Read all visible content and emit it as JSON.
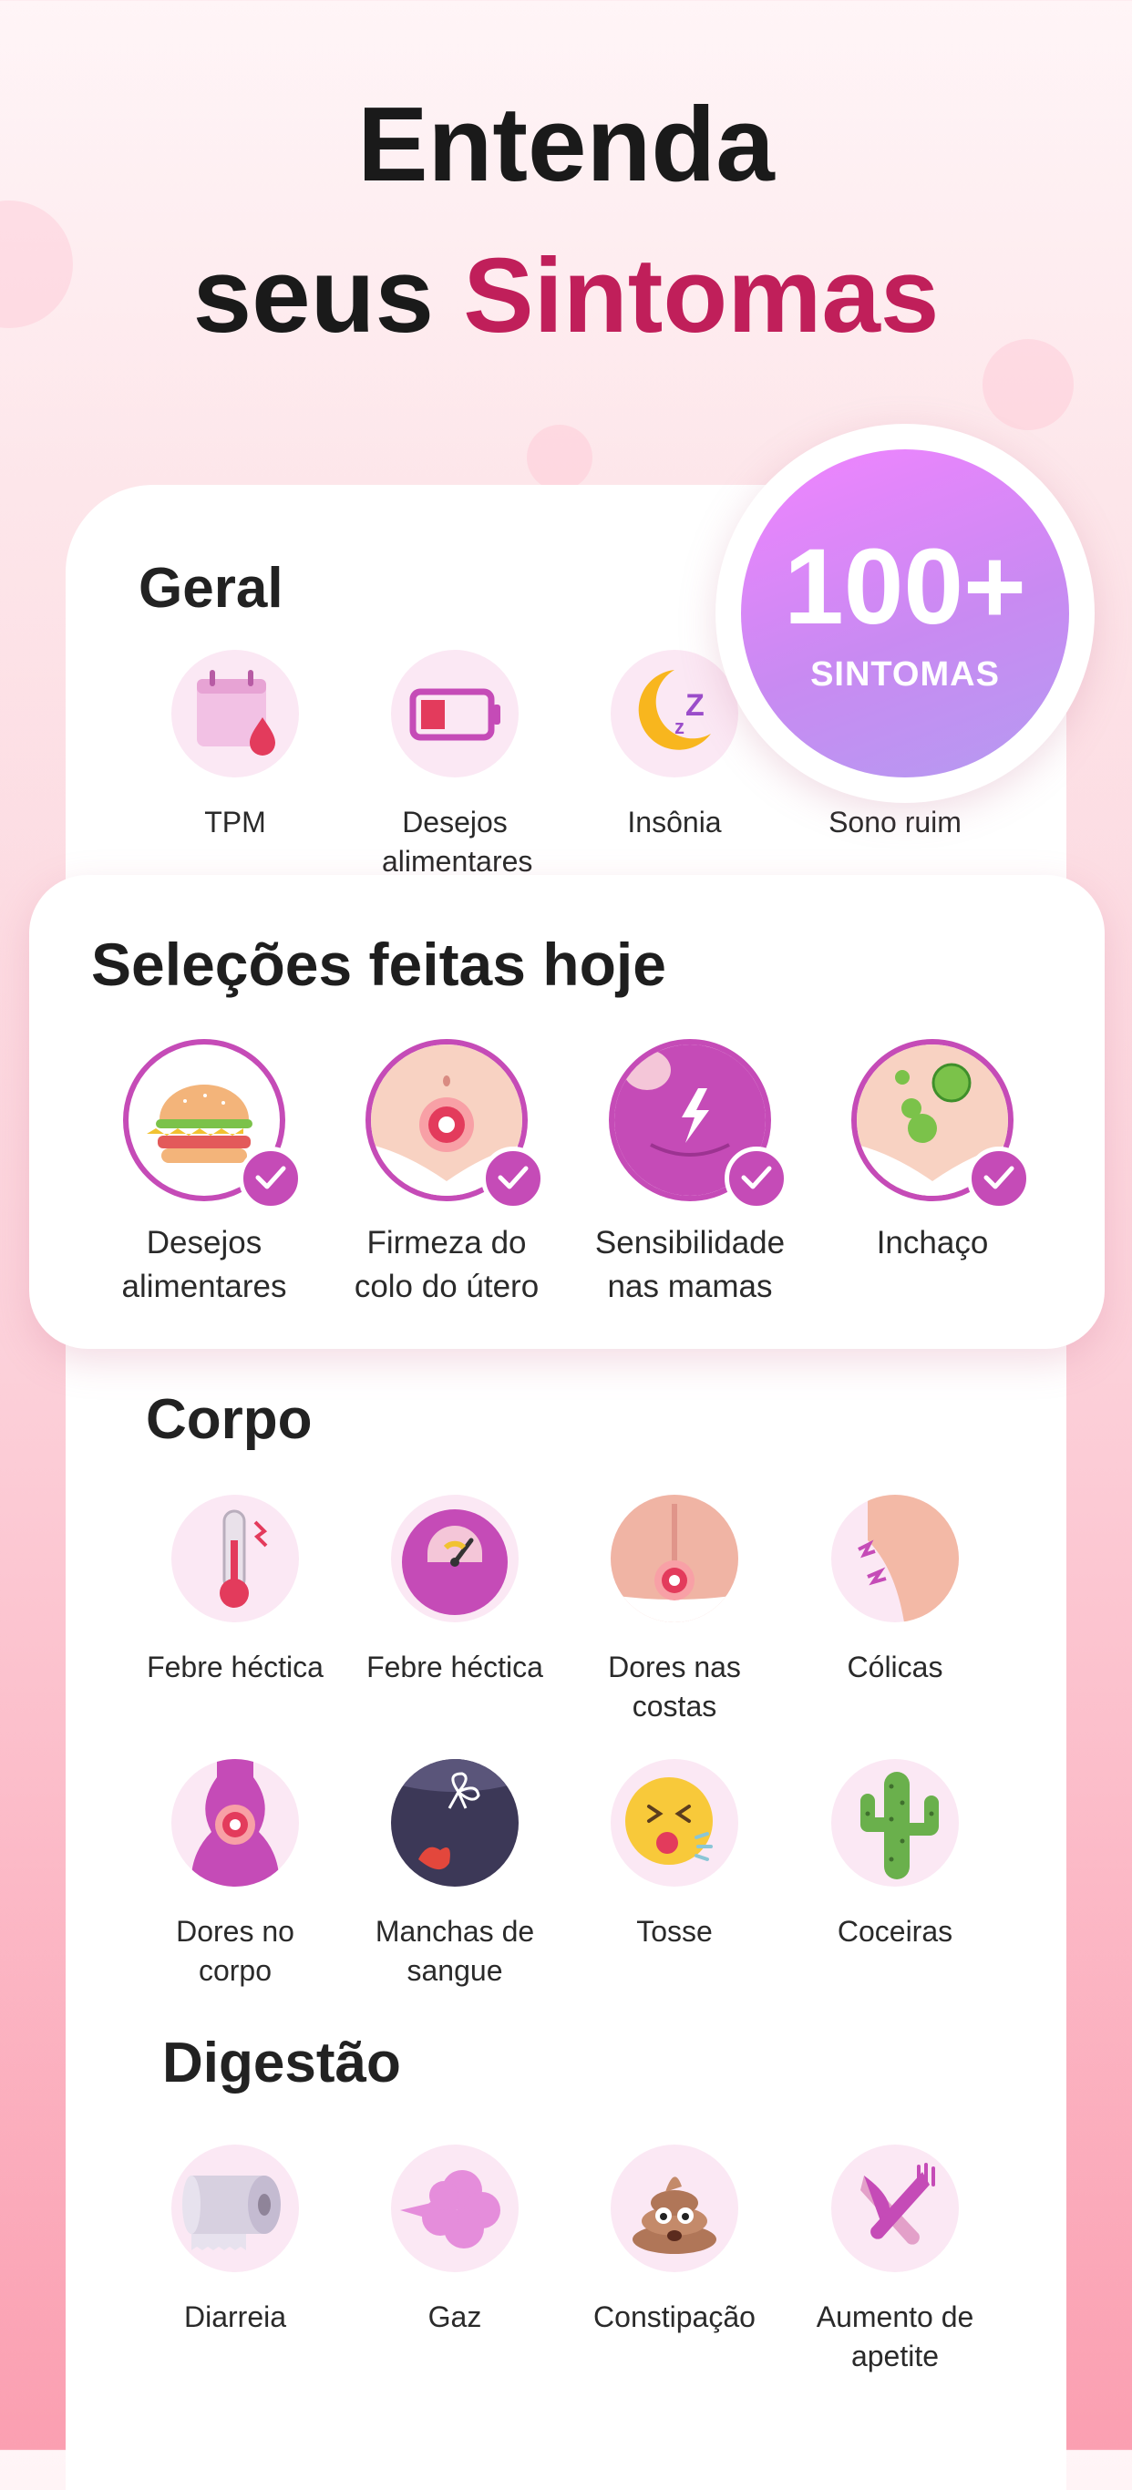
{
  "headline": {
    "line1": "Entenda",
    "line2_plain": "seus",
    "line2_accent": "Sintomas"
  },
  "badge": {
    "number": "100+",
    "label": "SINTOMAS"
  },
  "sections": {
    "geral": {
      "title": "Geral",
      "items": [
        {
          "label": "TPM",
          "icon": "calendar-drop-icon"
        },
        {
          "label": "Desejos alimentares",
          "icon": "low-battery-icon"
        },
        {
          "label": "Insônia",
          "icon": "moon-zzz-icon"
        },
        {
          "label": "Sono ruim",
          "icon": "sleep-icon"
        }
      ]
    },
    "selections": {
      "title": "Seleções feitas hoje",
      "items": [
        {
          "label_line1": "Desejos",
          "label_line2": "alimentares",
          "icon": "burger-icon"
        },
        {
          "label_line1": "Firmeza do",
          "label_line2": "colo do útero",
          "icon": "cervix-icon"
        },
        {
          "label_line1": "Sensibilidade",
          "label_line2": "nas mamas",
          "icon": "breast-lightning-icon"
        },
        {
          "label_line1": "Inchaço",
          "label_line2": "",
          "icon": "bloating-icon"
        }
      ]
    },
    "corpo": {
      "title": "Corpo",
      "items": [
        {
          "label_line1": "Febre héctica",
          "label_line2": "",
          "icon": "thermometer-icon"
        },
        {
          "label_line1": "Febre héctica",
          "label_line2": "",
          "icon": "scale-icon"
        },
        {
          "label_line1": "Dores nas",
          "label_line2": "costas",
          "icon": "back-pain-icon"
        },
        {
          "label_line1": "Cólicas",
          "label_line2": "",
          "icon": "cramps-icon"
        },
        {
          "label_line1": "Dores no",
          "label_line2": "corpo",
          "icon": "body-pain-icon"
        },
        {
          "label_line1": "Manchas de",
          "label_line2": "sangue",
          "icon": "blood-stain-icon"
        },
        {
          "label_line1": "Tosse",
          "label_line2": "",
          "icon": "cough-face-icon"
        },
        {
          "label_line1": "Coceiras",
          "label_line2": "",
          "icon": "cactus-icon"
        }
      ]
    },
    "digestao": {
      "title": "Digestão",
      "items": [
        {
          "label_line1": "Diarreia",
          "label_line2": "",
          "icon": "toilet-paper-icon"
        },
        {
          "label_line1": "Gaz",
          "label_line2": "",
          "icon": "gas-cloud-icon"
        },
        {
          "label_line1": "Constipação",
          "label_line2": "",
          "icon": "poop-icon"
        },
        {
          "label_line1": "Aumento de",
          "label_line2": "apetite",
          "icon": "fork-knife-icon"
        }
      ]
    }
  },
  "colors": {
    "accent": "#c01f5a",
    "badge_start": "#f184ff",
    "badge_end": "#b59af1",
    "check": "#c54bb7",
    "icon_bg": "#fbe8f4"
  }
}
